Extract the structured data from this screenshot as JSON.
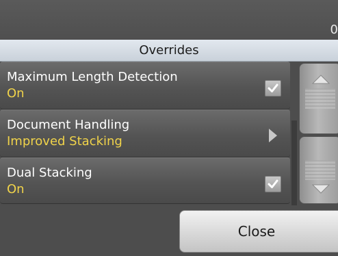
{
  "status": {
    "counter": "0"
  },
  "header": {
    "title": "Overrides"
  },
  "list": {
    "items": [
      {
        "title": "Maximum Length Detection",
        "value": "On",
        "control": "checkbox",
        "checked": true,
        "icon": "checkmark-icon"
      },
      {
        "title": "Document Handling",
        "value": "Improved Stacking",
        "control": "submenu",
        "icon": "chevron-right-icon"
      },
      {
        "title": "Dual Stacking",
        "value": "On",
        "control": "checkbox",
        "checked": true,
        "icon": "checkmark-icon"
      }
    ]
  },
  "scroll": {
    "up_icon": "arrow-up-icon",
    "down_icon": "arrow-down-icon"
  },
  "footer": {
    "close_label": "Close"
  },
  "colors": {
    "value_text": "#f0d34a",
    "header_bg": "#d6dde5",
    "background": "#4d4d4d"
  }
}
